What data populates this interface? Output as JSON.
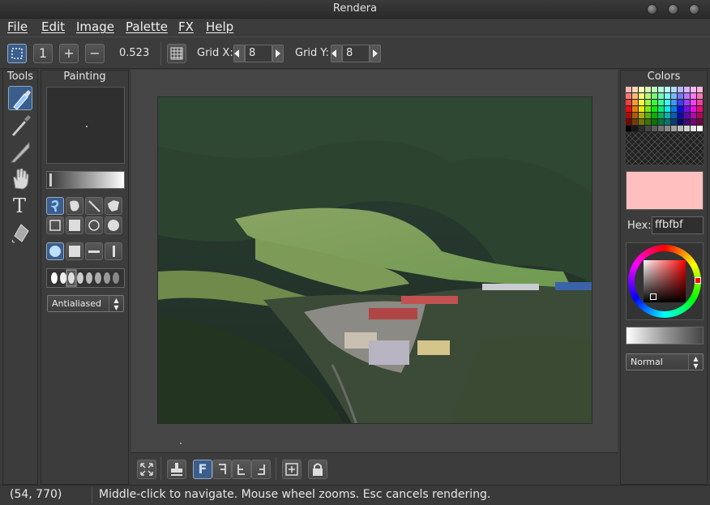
{
  "app": {
    "title": "Rendera"
  },
  "menu": [
    "File",
    "Edit",
    "Image",
    "Palette",
    "FX",
    "Help"
  ],
  "toolbar": {
    "zoom_value": "0.523",
    "grid_x_label": "Grid X:",
    "grid_x_value": "8",
    "grid_y_label": "Grid Y:",
    "grid_y_value": "8",
    "one_label": "1"
  },
  "tools": {
    "title": "Tools",
    "items": [
      "paint-tool",
      "eyedropper-tool",
      "knife-tool",
      "hand-tool",
      "text-tool",
      "fill-tool"
    ]
  },
  "painting": {
    "title": "Painting",
    "antialias_option": "Antialiased"
  },
  "colors": {
    "title": "Colors",
    "hex_label": "Hex:",
    "hex_value": "ffbfbf",
    "current_color": "#ffbfbf",
    "blend_option": "Normal"
  },
  "bottom": {
    "filter_label": "F"
  },
  "status": {
    "coords": "(54, 770)",
    "message": "Middle-click to navigate. Mouse wheel zooms. Esc cancels rendering."
  }
}
